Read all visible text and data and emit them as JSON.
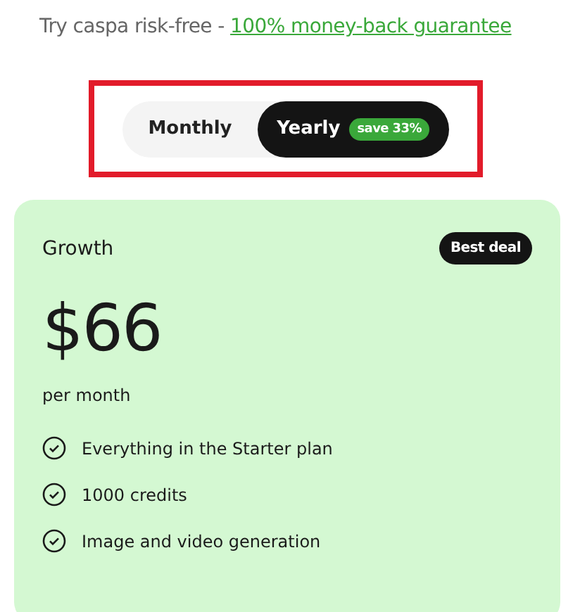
{
  "guarantee": {
    "text": "Try caspa risk-free - ",
    "link": "100% money-back guarantee"
  },
  "billing_toggle": {
    "highlighted": true,
    "options": [
      {
        "label": "Monthly",
        "selected": false
      },
      {
        "label": "Yearly",
        "selected": true,
        "badge": "save 33%"
      }
    ]
  },
  "plan": {
    "name": "Growth",
    "badge": "Best deal",
    "price": "$66",
    "period": "per month",
    "features": [
      {
        "text": "Everything in the Starter plan"
      },
      {
        "text": "1000 credits"
      },
      {
        "text": "Image and video generation"
      }
    ]
  }
}
